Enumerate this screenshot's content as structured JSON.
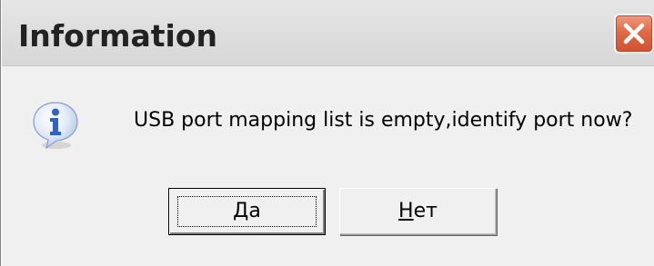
{
  "window": {
    "title": "Information"
  },
  "message": {
    "text": "USB port mapping list is empty,identify port now?",
    "icon": "info-icon"
  },
  "buttons": {
    "yes": {
      "accel": "Д",
      "rest": "а"
    },
    "no": {
      "accel": "Н",
      "rest": "ет"
    }
  },
  "colors": {
    "close_button": "#e06a48",
    "client_bg": "#f0f0f0",
    "icon_blue": "#3a6fd0"
  }
}
